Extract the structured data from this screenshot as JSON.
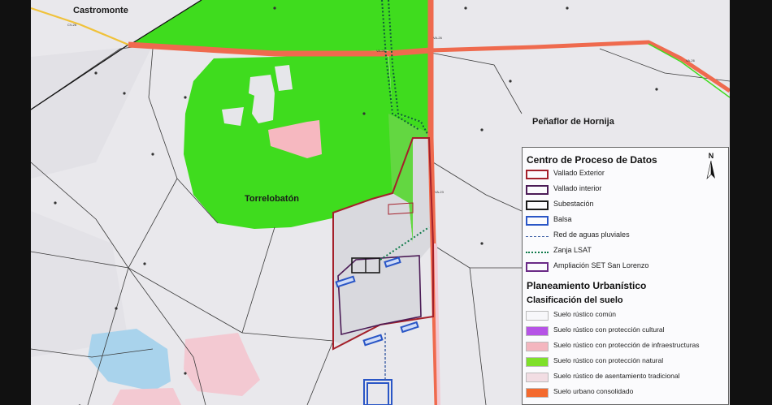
{
  "towns": {
    "castromonte": "Castromonte",
    "penaflor": "Peñaflor de Hornija",
    "torrelobaton": "Torrelobatón"
  },
  "road_labels": [
    "CV-26",
    "VA-26",
    "VA-26",
    "VA-26",
    "VA-23"
  ],
  "legend": {
    "north": "N",
    "section1_title": "Centro de Proceso de Datos",
    "items1": [
      {
        "label": "Vallado Exterior",
        "kind": "box",
        "stroke": "#a4202a"
      },
      {
        "label": "Vallado interior",
        "kind": "box",
        "stroke": "#4b1b56"
      },
      {
        "label": "Subestación",
        "kind": "box",
        "stroke": "#1a1a1a"
      },
      {
        "label": "Balsa",
        "kind": "box",
        "stroke": "#2a56c6"
      },
      {
        "label": "Red de aguas pluviales",
        "kind": "dash",
        "stroke": "#3d5fa6"
      },
      {
        "label": "Zanja LSAT",
        "kind": "dots",
        "stroke": "#0f7a4a"
      },
      {
        "label": "Ampliación SET San Lorenzo",
        "kind": "box",
        "stroke": "#6a2a86"
      }
    ],
    "section2_title": "Planeamiento Urbanístico",
    "section3_title": "Clasificación del suelo",
    "items2": [
      {
        "label": "Suelo rústico común",
        "fill": "#f7f7fa"
      },
      {
        "label": "Suelo rústico con protección cultural",
        "fill": "#b653e6"
      },
      {
        "label": "Suelo rústico con protección de infraestructuras",
        "fill": "#f4b6bf"
      },
      {
        "label": "Suelo rústico con protección natural",
        "fill": "#7fe02a"
      },
      {
        "label": "Suelo rústico de asentamiento tradicional",
        "fill": "#f2dde3"
      },
      {
        "label": "Suelo urbano consolidado",
        "fill": "#f46a2e"
      }
    ]
  },
  "colors": {
    "map_bg": "#e9e8ec",
    "natural": "#3fdc1e",
    "infra": "#f6b8c0",
    "road": "#ef6a4e",
    "water": "#a9d3ec"
  }
}
